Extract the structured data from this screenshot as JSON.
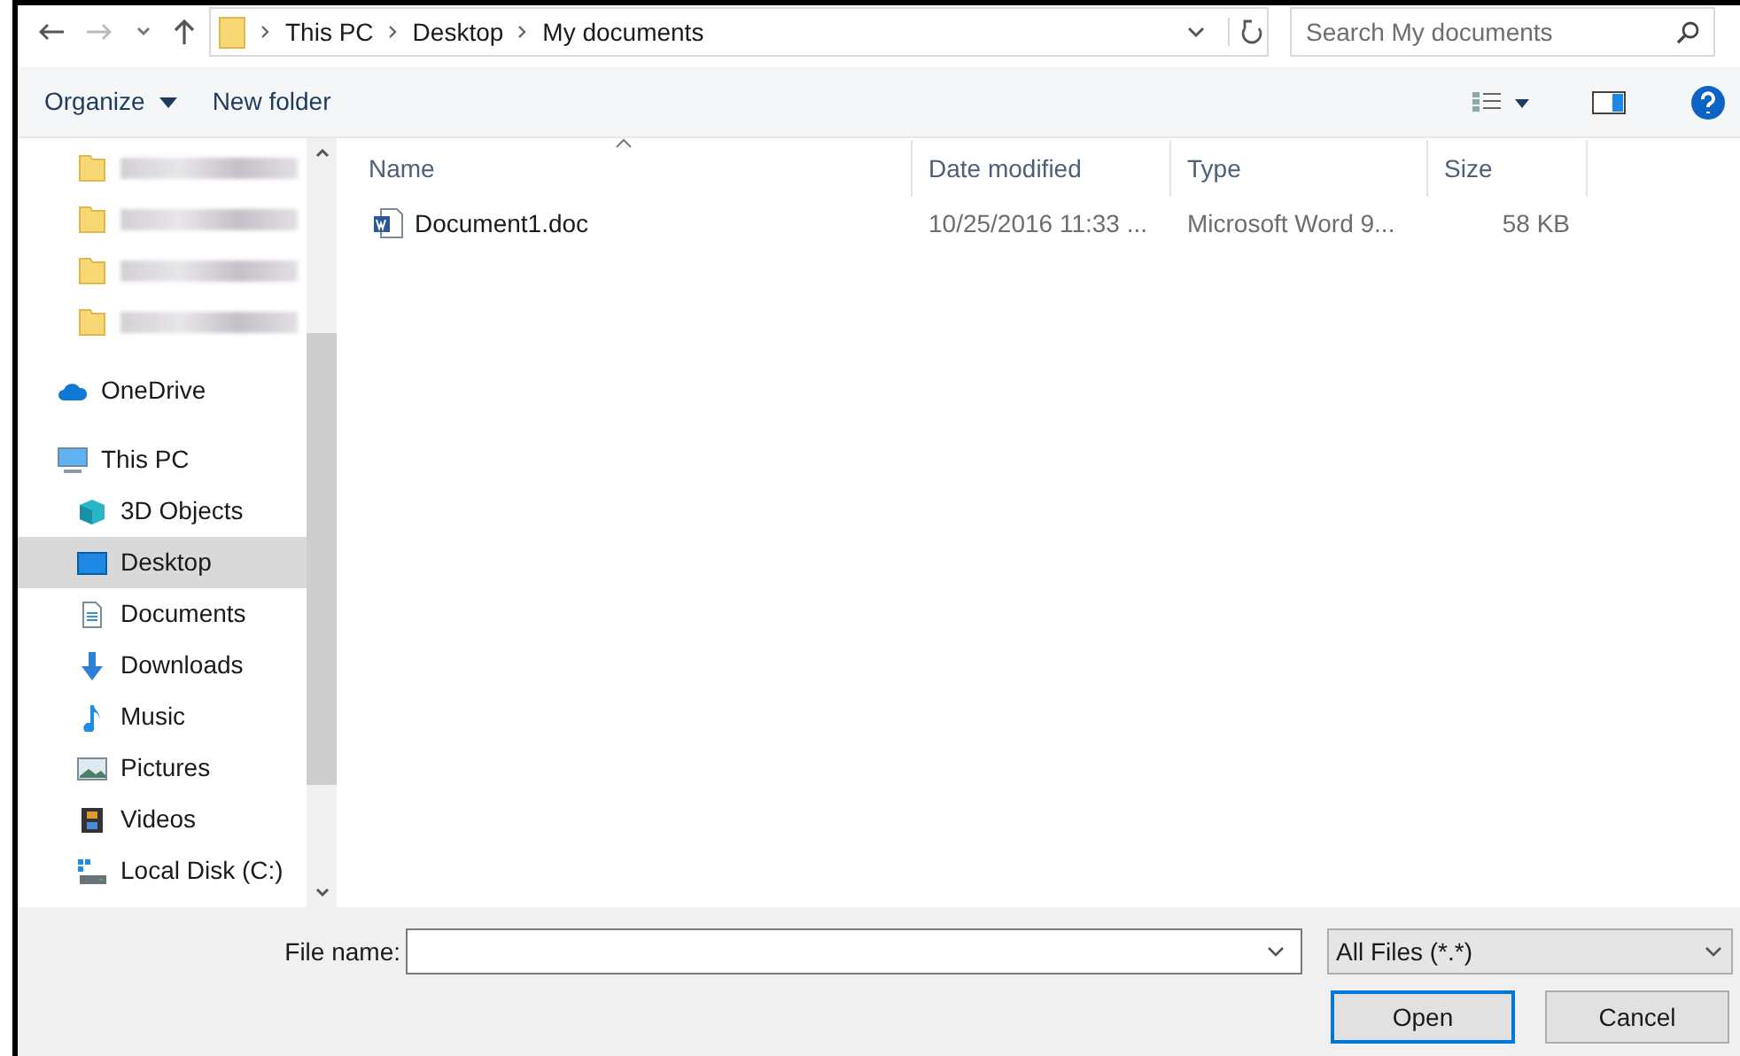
{
  "address": {
    "crumbs": [
      "This PC",
      "Desktop",
      "My documents"
    ]
  },
  "search": {
    "placeholder": "Search My documents"
  },
  "toolbar": {
    "buttons": [
      "Organize",
      "New folder"
    ]
  },
  "nav": [
    {
      "kind": "redacted",
      "selected": false
    },
    {
      "kind": "redacted",
      "selected": false
    },
    {
      "kind": "redacted",
      "selected": false
    },
    {
      "kind": "redacted",
      "selected": false
    },
    {
      "kind": "onedrive",
      "label": "OneDrive",
      "selected": false
    },
    {
      "kind": "pc",
      "label": "This PC",
      "selected": false
    },
    {
      "kind": "cube",
      "label": "3D Objects",
      "selected": false
    },
    {
      "kind": "desktop",
      "label": "Desktop",
      "selected": true
    },
    {
      "kind": "documents",
      "label": "Documents",
      "selected": false
    },
    {
      "kind": "downloads",
      "label": "Downloads",
      "selected": false
    },
    {
      "kind": "music",
      "label": "Music",
      "selected": false
    },
    {
      "kind": "pictures",
      "label": "Pictures",
      "selected": false
    },
    {
      "kind": "videos",
      "label": "Videos",
      "selected": false
    },
    {
      "kind": "disk",
      "label": "Local Disk (C:)",
      "selected": false
    }
  ],
  "table": {
    "columns": [
      "Name",
      "Date modified",
      "Type",
      "Size"
    ],
    "rows": [
      {
        "name": "Document1.doc",
        "date": "10/25/2016 11:33 ...",
        "type": "Microsoft Word 9...",
        "size": "58 KB"
      }
    ]
  },
  "file_name": {
    "label": "File name:"
  },
  "file_type": {
    "value": "All Files (*.*)"
  },
  "buttons": [
    {
      "label": "Open",
      "default": true
    },
    {
      "label": "Cancel",
      "default": false
    }
  ]
}
